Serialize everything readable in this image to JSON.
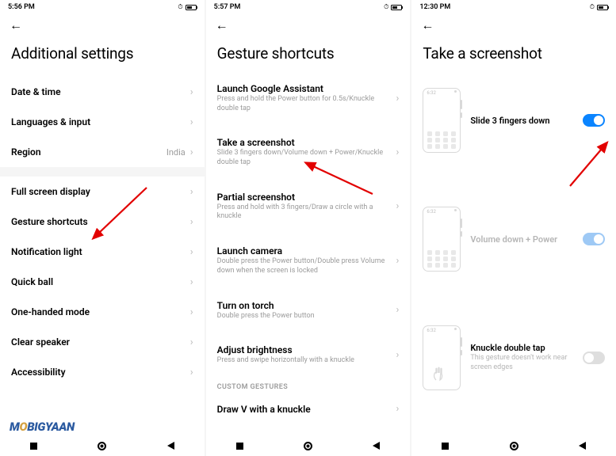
{
  "panels": [
    {
      "time": "5:56 PM",
      "battery": "51",
      "title": "Additional settings",
      "sections": [
        {
          "rows": [
            {
              "label": "Date & time"
            },
            {
              "label": "Languages & input"
            },
            {
              "label": "Region",
              "value": "India"
            }
          ]
        },
        {
          "rows": [
            {
              "label": "Full screen display"
            },
            {
              "label": "Gesture shortcuts"
            },
            {
              "label": "Notification light"
            },
            {
              "label": "Quick ball"
            },
            {
              "label": "One-handed mode"
            },
            {
              "label": "Clear speaker"
            },
            {
              "label": "Accessibility"
            }
          ]
        }
      ]
    },
    {
      "time": "5:57 PM",
      "battery": "51",
      "title": "Gesture shortcuts",
      "rows": [
        {
          "label": "Launch Google Assistant",
          "sub": "Press and hold the Power button for 0.5s/Knuckle double tap"
        },
        {
          "label": "Take a screenshot",
          "sub": "Slide 3 fingers down/Volume down + Power/Knuckle double tap"
        },
        {
          "label": "Partial screenshot",
          "sub": "Press and hold with 3 fingers/Draw a circle with a knuckle"
        },
        {
          "label": "Launch camera",
          "sub": "Double press the Power button/Double press Volume down when the screen is locked"
        },
        {
          "label": "Turn on torch",
          "sub": "Double press the Power button"
        },
        {
          "label": "Adjust brightness",
          "sub": "Press and swipe horizontally with a knuckle"
        }
      ],
      "section_label": "CUSTOM GESTURES",
      "rows2": [
        {
          "label": "Draw V with a knuckle"
        }
      ]
    },
    {
      "time": "12:30 PM",
      "battery": "49",
      "title": "Take a screenshot",
      "phone_clock": "6:32",
      "options": [
        {
          "label": "Slide 3 fingers down",
          "toggle": "on-active"
        },
        {
          "label": "Volume down + Power",
          "toggle": "on-light",
          "disabled": true
        },
        {
          "label": "Knuckle double tap",
          "sub": "This gesture doesn't work near screen edges",
          "toggle": "off"
        }
      ]
    }
  ],
  "watermark": {
    "pre": "M",
    "o": "O",
    "rest": "BIGYAAN"
  }
}
